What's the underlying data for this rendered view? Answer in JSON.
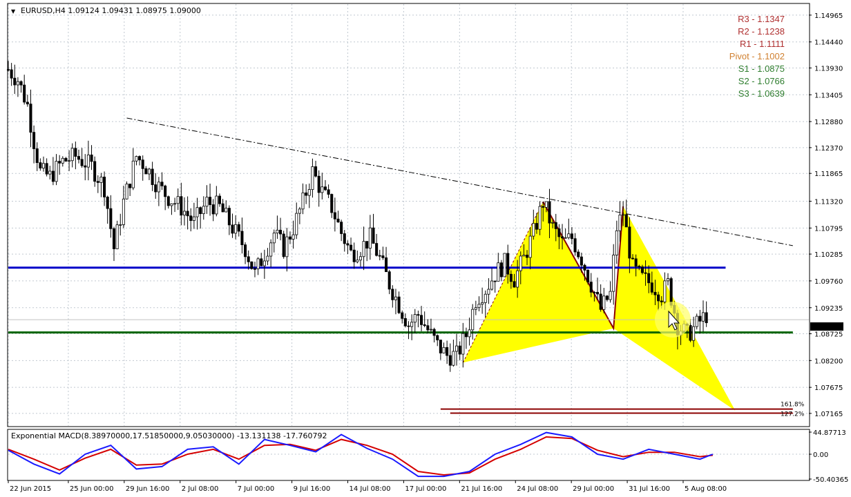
{
  "window": {
    "symbol_header": "EURUSD,H4  1.09124 1.09431 1.08975 1.09000",
    "collapse_glyph": "▼",
    "colors": {
      "background": "#ffffff",
      "grid": "#c0c8d0",
      "bull_candle": "#000000",
      "pivot_blue": "#0000c8",
      "pivot_green": "#006400",
      "pattern_fill": "#ffff00",
      "pattern_edge": "#8b0000",
      "trendline": "#000000",
      "macd_main": "#1a1aff",
      "macd_signal": "#d40000",
      "cursor_highlight": "#ffff66"
    },
    "current_price_label": "1.09000"
  },
  "pivot_levels": [
    {
      "label": "R3 - 1.1347",
      "value": 1.1347,
      "color": "#b03030"
    },
    {
      "label": "R2 - 1.1238",
      "value": 1.1238,
      "color": "#b03030"
    },
    {
      "label": "R1 - 1.1111",
      "value": 1.1111,
      "color": "#b03030"
    },
    {
      "label": "Pivot - 1.1002",
      "value": 1.1002,
      "color": "#d08030"
    },
    {
      "label": "S1 - 1.0875",
      "value": 1.0875,
      "color": "#2e7d2e"
    },
    {
      "label": "S2 - 1.0766",
      "value": 1.0766,
      "color": "#2e7d2e"
    },
    {
      "label": "S3 - 1.0639",
      "value": 1.0639,
      "color": "#2e7d2e"
    }
  ],
  "fib_labels": [
    "161.8%",
    "127.2%"
  ],
  "macd": {
    "title": "Exponential MACD(8.38970000,17.51850000,9.05030000) -13.131138 -17.760792",
    "y_ticks": [
      "44.87713",
      "0.00",
      "-50.40365"
    ],
    "y_values": [
      44.87713,
      0,
      -50.40365
    ]
  },
  "chart_data": {
    "type": "candlestick",
    "symbol": "EURUSD",
    "timeframe": "H4",
    "ohlc_last": {
      "open": 1.09124,
      "high": 1.09431,
      "low": 1.08975,
      "close": 1.09
    },
    "ylim": [
      1.0692,
      1.1518
    ],
    "y_ticks": [
      "1.14965",
      "1.14440",
      "1.13930",
      "1.13405",
      "1.12880",
      "1.12370",
      "1.11865",
      "1.11320",
      "1.10795",
      "1.10285",
      "1.09760",
      "1.09235",
      "1.08725",
      "1.08200",
      "1.07675",
      "1.07165"
    ],
    "y_tick_values": [
      1.14965,
      1.1444,
      1.1393,
      1.13405,
      1.1288,
      1.1237,
      1.11865,
      1.1132,
      1.10795,
      1.10285,
      1.0976,
      1.09235,
      1.08725,
      1.082,
      1.07675,
      1.07165
    ],
    "x_ticks": [
      "22 Jun 2015",
      "25 Jun 00:00",
      "29 Jun 16:00",
      "2 Jul 08:00",
      "7 Jul 00:00",
      "9 Jul 16:00",
      "14 Jul 08:00",
      "17 Jul 00:00",
      "21 Jul 16:00",
      "24 Jul 08:00",
      "29 Jul 00:00",
      "31 Jul 16:00",
      "5 Aug 08:00"
    ],
    "close_path": [
      [
        0,
        1.139
      ],
      [
        3,
        1.137
      ],
      [
        6,
        1.132
      ],
      [
        8,
        1.125
      ],
      [
        10,
        1.119
      ],
      [
        13,
        1.118
      ],
      [
        17,
        1.121
      ],
      [
        21,
        1.122
      ],
      [
        26,
        1.12
      ],
      [
        30,
        1.116
      ],
      [
        33,
        1.104
      ],
      [
        36,
        1.113
      ],
      [
        40,
        1.122
      ],
      [
        43,
        1.12
      ],
      [
        47,
        1.116
      ],
      [
        50,
        1.114
      ],
      [
        54,
        1.112
      ],
      [
        58,
        1.109
      ],
      [
        62,
        1.113
      ],
      [
        66,
        1.112
      ],
      [
        70,
        1.108
      ],
      [
        74,
        1.104
      ],
      [
        77,
        1.099
      ],
      [
        80,
        1.103
      ],
      [
        83,
        1.107
      ],
      [
        86,
        1.104
      ],
      [
        89,
        1.108
      ],
      [
        92,
        1.113
      ],
      [
        95,
        1.119
      ],
      [
        98,
        1.115
      ],
      [
        101,
        1.112
      ],
      [
        104,
        1.107
      ],
      [
        107,
        1.103
      ],
      [
        110,
        1.104
      ],
      [
        113,
        1.106
      ],
      [
        116,
        1.102
      ],
      [
        119,
        1.097
      ],
      [
        122,
        1.093
      ],
      [
        125,
        1.089
      ],
      [
        128,
        1.091
      ],
      [
        131,
        1.088
      ],
      [
        134,
        1.085
      ],
      [
        137,
        1.083
      ],
      [
        140,
        1.083
      ],
      [
        143,
        1.087
      ],
      [
        146,
        1.094
      ],
      [
        149,
        1.096
      ],
      [
        152,
        1.099
      ],
      [
        155,
        1.101
      ],
      [
        158,
        1.098
      ],
      [
        161,
        1.102
      ],
      [
        164,
        1.107
      ],
      [
        167,
        1.113
      ],
      [
        170,
        1.108
      ],
      [
        173,
        1.105
      ],
      [
        176,
        1.106
      ],
      [
        179,
        1.102
      ],
      [
        182,
        1.097
      ],
      [
        185,
        1.092
      ],
      [
        188,
        1.095
      ],
      [
        190,
        1.108
      ],
      [
        192,
        1.111
      ],
      [
        195,
        1.1
      ],
      [
        198,
        1.098
      ],
      [
        201,
        1.097
      ],
      [
        204,
        1.095
      ],
      [
        206,
        1.097
      ],
      [
        209,
        1.089
      ],
      [
        212,
        1.087
      ],
      [
        215,
        1.089
      ],
      [
        218,
        1.091
      ]
    ],
    "trendline": [
      [
        37,
        1.1295
      ],
      [
        245,
        1.1045
      ]
    ],
    "horizontal_lines": [
      {
        "name": "",
        "value": 1.1002,
        "color": "#0000c8",
        "from": 0,
        "to": 224
      },
      {
        "name": "",
        "value": 1.0875,
        "color": "#006400",
        "from": 0,
        "to": 245
      }
    ],
    "pattern_points": [
      [
        142,
        1.0816
      ],
      [
        167,
        1.1131
      ],
      [
        189,
        1.0883
      ],
      [
        192,
        1.1122
      ],
      [
        227,
        1.0722
      ]
    ],
    "fib_lines": [
      {
        "label": "161.8%",
        "value": 1.0725,
        "from": 135,
        "to": 245
      },
      {
        "label": "127.2%",
        "value": 1.0717,
        "from": 138,
        "to": 245
      }
    ],
    "grid": true,
    "macd_series": {
      "x": [
        0,
        8,
        16,
        24,
        32,
        40,
        48,
        56,
        64,
        72,
        80,
        88,
        96,
        104,
        112,
        120,
        128,
        136,
        144,
        152,
        160,
        168,
        176,
        184,
        192,
        200,
        208,
        216,
        220
      ],
      "main": [
        8,
        -20,
        -40,
        0,
        18,
        -30,
        -25,
        10,
        15,
        -20,
        30,
        18,
        5,
        40,
        12,
        -10,
        -45,
        -45,
        -35,
        0,
        20,
        44,
        35,
        0,
        -10,
        10,
        0,
        -10,
        0
      ],
      "signal": [
        10,
        -10,
        -32,
        -8,
        10,
        -22,
        -20,
        0,
        10,
        -10,
        18,
        20,
        8,
        30,
        18,
        0,
        -35,
        -42,
        -38,
        -10,
        10,
        35,
        32,
        8,
        -5,
        4,
        4,
        -5,
        -2
      ]
    }
  }
}
